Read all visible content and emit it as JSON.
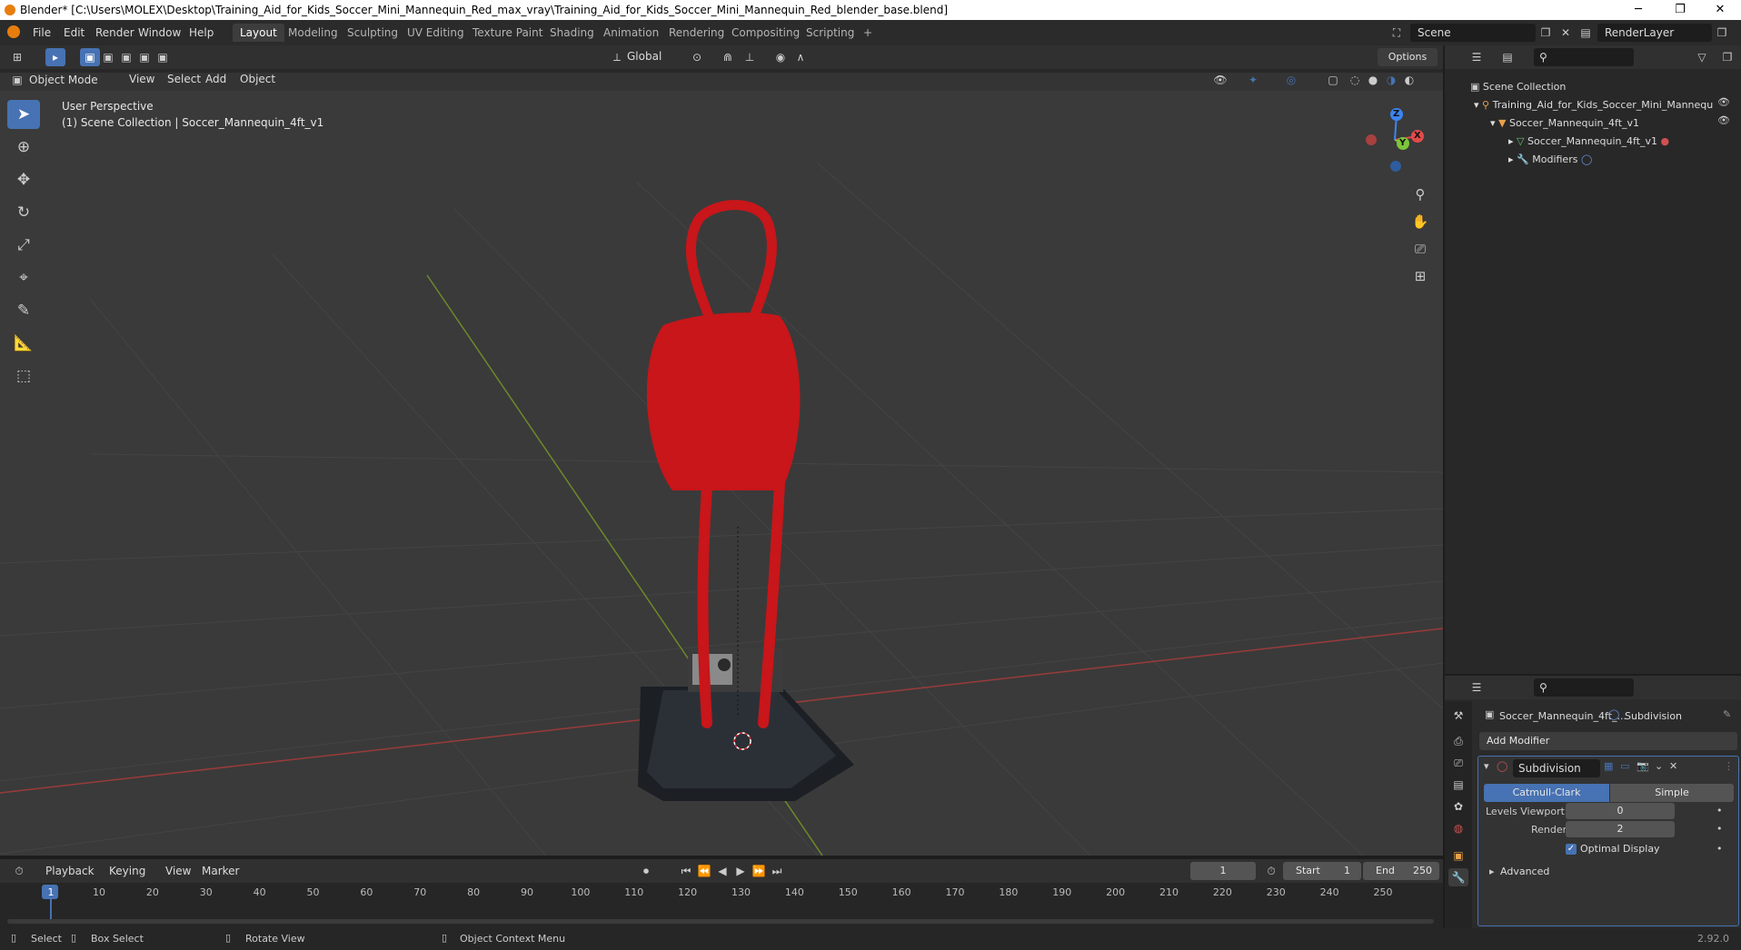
{
  "window": {
    "title": "Blender* [C:\\Users\\MOLEX\\Desktop\\Training_Aid_for_Kids_Soccer_Mini_Mannequin_Red_max_vray\\Training_Aid_for_Kids_Soccer_Mini_Mannequin_Red_blender_base.blend]",
    "minimize": "─",
    "maximize": "❐",
    "close": "✕"
  },
  "menus": [
    "File",
    "Edit",
    "Render",
    "Window",
    "Help"
  ],
  "workspaces": [
    "Layout",
    "Modeling",
    "Sculpting",
    "UV Editing",
    "Texture Paint",
    "Shading",
    "Animation",
    "Rendering",
    "Compositing",
    "Scripting"
  ],
  "workspace_add": "+",
  "scene": {
    "name": "Scene",
    "render_layer": "RenderLayer"
  },
  "tool_header": {
    "orientation": "Global",
    "options": "Options"
  },
  "viewport_header": {
    "mode": "Object Mode",
    "menus": [
      "View",
      "Select",
      "Add",
      "Object"
    ]
  },
  "viewport": {
    "perspective": "User Perspective",
    "collection_info": "(1) Scene Collection | Soccer_Mannequin_4ft_v1"
  },
  "gizmo": {
    "x": "X",
    "y": "Y",
    "z": "Z"
  },
  "outliner": {
    "root": "Scene Collection",
    "items": [
      {
        "label": "Training_Aid_for_Kids_Soccer_Mini_Mannequ"
      },
      {
        "label": "Soccer_Mannequin_4ft_v1"
      },
      {
        "label": "Soccer_Mannequin_4ft_v1"
      },
      {
        "label": "Modifiers"
      }
    ]
  },
  "properties": {
    "object_name": "Soccer_Mannequin_4ft_...",
    "modifier_tab": "Subdivision",
    "add_modifier": "Add Modifier",
    "modifier_name": "Subdivision",
    "type_options": [
      "Catmull-Clark",
      "Simple"
    ],
    "levels_viewport_label": "Levels Viewport",
    "levels_viewport": "0",
    "render_label": "Render",
    "render_value": "2",
    "optimal_display": "Optimal Display",
    "advanced": "Advanced"
  },
  "timeline": {
    "menus": [
      "Playback",
      "Keying",
      "View",
      "Marker"
    ],
    "current_frame": "1",
    "start_label": "Start",
    "start": "1",
    "end_label": "End",
    "end": "250",
    "ticks": [
      "1",
      "10",
      "20",
      "30",
      "40",
      "50",
      "60",
      "70",
      "80",
      "90",
      "100",
      "110",
      "120",
      "130",
      "140",
      "150",
      "160",
      "170",
      "180",
      "190",
      "200",
      "210",
      "220",
      "230",
      "240",
      "250"
    ]
  },
  "statusbar": {
    "select": "Select",
    "box_select": "Box Select",
    "rotate": "Rotate View",
    "context_menu": "Object Context Menu",
    "version": "2.92.0"
  },
  "colors": {
    "accent": "#4772b3",
    "mannequin": "#c8161a",
    "grid_x": "#9a3b3b",
    "grid_y": "#6b8a2a",
    "blender_orange": "#e87d0d"
  }
}
